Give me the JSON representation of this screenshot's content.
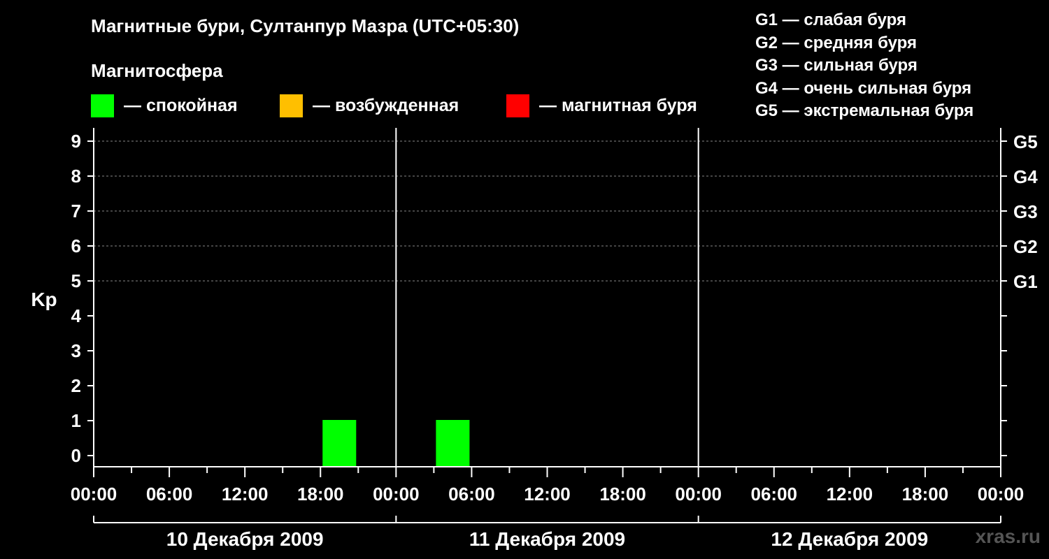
{
  "title": "Магнитные бури, Султанпур Мазра (UTC+05:30)",
  "subtitle": "Магнитосфера",
  "legend": [
    {
      "label": "— спокойная",
      "color": "#00ff00"
    },
    {
      "label": "— возбужденная",
      "color": "#ffbf00"
    },
    {
      "label": "— магнитная буря",
      "color": "#ff0000"
    }
  ],
  "g_scale": [
    "G1 — слабая буря",
    "G2 — средняя буря",
    "G3 — сильная буря",
    "G4 — очень сильная буря",
    "G5 — экстремальная буря"
  ],
  "watermark": "xras.ru",
  "chart_data": {
    "type": "bar",
    "ylabel": "Kp",
    "ylim": [
      0,
      9
    ],
    "y_ticks": [
      "0",
      "1",
      "2",
      "3",
      "4",
      "5",
      "6",
      "7",
      "8",
      "9"
    ],
    "right_ticks": [
      {
        "kp": 5,
        "label": "G1"
      },
      {
        "kp": 6,
        "label": "G2"
      },
      {
        "kp": 7,
        "label": "G3"
      },
      {
        "kp": 8,
        "label": "G4"
      },
      {
        "kp": 9,
        "label": "G5"
      }
    ],
    "x_tick_labels": [
      "00:00",
      "06:00",
      "12:00",
      "18:00",
      "00:00",
      "06:00",
      "12:00",
      "18:00",
      "00:00",
      "06:00",
      "12:00",
      "18:00",
      "00:00"
    ],
    "days": [
      "10 Декабря 2009",
      "11 Декабря 2009",
      "12 Декабря 2009"
    ],
    "grid": true,
    "bars": [
      {
        "day": 0,
        "start_hour": 18,
        "end_hour": 21,
        "kp": 1,
        "status": "спокойная",
        "color": "#00ff00"
      },
      {
        "day": 1,
        "start_hour": 3,
        "end_hour": 6,
        "kp": 1,
        "status": "спокойная",
        "color": "#00ff00"
      }
    ]
  }
}
